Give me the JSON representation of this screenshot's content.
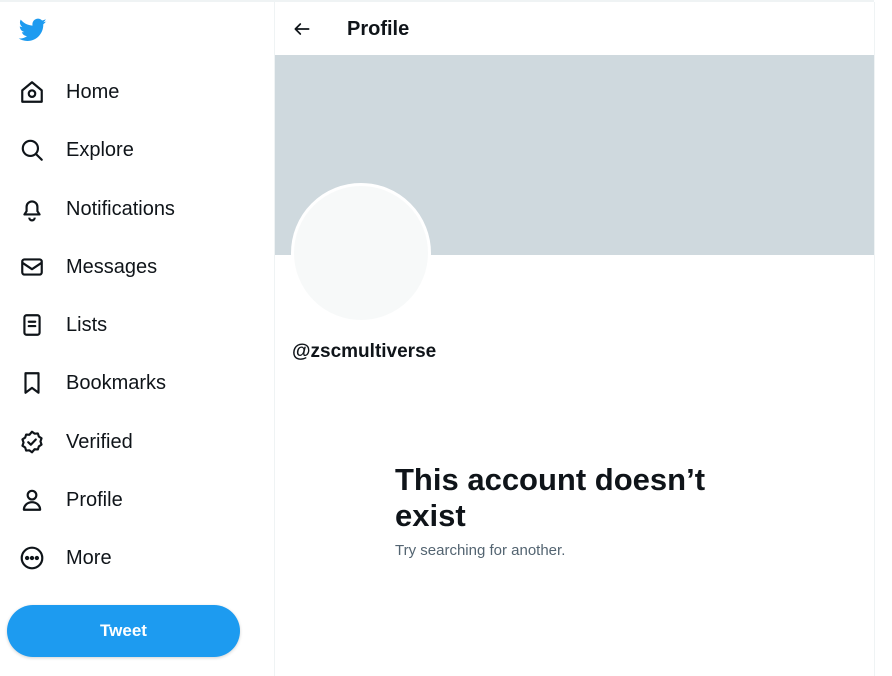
{
  "colors": {
    "brand": "#1d9bf0",
    "text_primary": "#0f1419",
    "text_secondary": "#536471",
    "banner": "#cfd9de",
    "avatar_bg": "#f7f9f9"
  },
  "sidebar": {
    "logo_icon": "twitter-bird-icon",
    "items": [
      {
        "label": "Home",
        "icon": "home-icon"
      },
      {
        "label": "Explore",
        "icon": "search-icon"
      },
      {
        "label": "Notifications",
        "icon": "bell-icon"
      },
      {
        "label": "Messages",
        "icon": "envelope-icon"
      },
      {
        "label": "Lists",
        "icon": "list-icon"
      },
      {
        "label": "Bookmarks",
        "icon": "bookmark-icon"
      },
      {
        "label": "Verified",
        "icon": "verified-badge-icon"
      },
      {
        "label": "Profile",
        "icon": "person-icon"
      },
      {
        "label": "More",
        "icon": "more-circle-icon"
      }
    ],
    "tweet_button_label": "Tweet"
  },
  "header": {
    "back_icon": "arrow-left-icon",
    "title": "Profile"
  },
  "profile": {
    "handle": "@zscmultiverse"
  },
  "empty_state": {
    "title": "This account doesn’t exist",
    "subtitle": "Try searching for another."
  }
}
